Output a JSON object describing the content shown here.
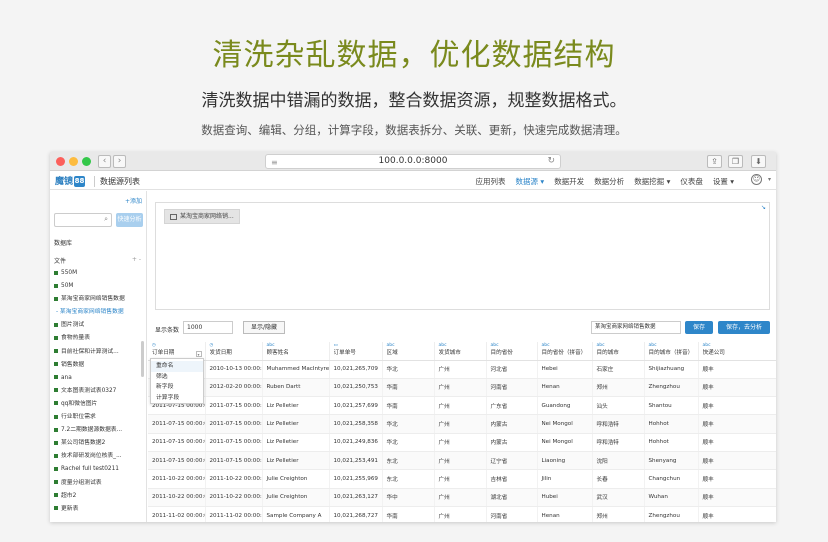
{
  "hero": {
    "title": "清洗杂乱数据，优化数据结构",
    "subtitle": "清洗数据中错漏的数据，整合数据资源，规整数据格式。",
    "description": "数据查询、编辑、分组，计算字段，数据表拆分、关联、更新，快速完成数据清理。"
  },
  "browser": {
    "url": "100.0.0.0:8000",
    "dot_colors": [
      "#fc605c",
      "#fdbc40",
      "#34c84a"
    ]
  },
  "app": {
    "logo_text": "魔镜",
    "logo_badge": "88",
    "page_title": "数据源列表",
    "nav": [
      "应用列表",
      "数据源",
      "数据开发",
      "数据分析",
      "数据挖掘",
      "仪表盘",
      "设置"
    ],
    "active_nav": "数据源"
  },
  "sidebar": {
    "add_label": "+添加",
    "quick_analyze": "快速分析",
    "database_label": "数据库",
    "file_label": "文件",
    "file_plus": "+ -",
    "items": [
      "550M",
      "50M",
      "某淘宝商家网络销售数据",
      "- 某淘宝商家网络销售数据",
      "图片测试",
      "食物热量表",
      "目前社保和计算测试...",
      "销售数据",
      "ana",
      "文本图表测试表0327",
      "qq和微信图片",
      "行业职位需求",
      "7.2二期数据源数据表...",
      "某公司销售数据2",
      "技术部研发岗位核表_...",
      "Rachel full test0211",
      "度量分组测试表",
      "超市2",
      "更新表"
    ],
    "active_index": 3
  },
  "canvas": {
    "table_chip": "某淘宝商家网络销..."
  },
  "controls": {
    "rows_label": "显示条数",
    "rows_value": "1000",
    "toggle_label": "显示/隐藏",
    "dataset_name": "某淘宝商家网络销售数据",
    "save": "保存",
    "save_analyze": "保存，去分析"
  },
  "dropdown": {
    "items": [
      "重命名",
      "筛选",
      "新字段",
      "计算字段"
    ]
  },
  "table": {
    "columns": [
      {
        "type": "◷",
        "name": "订单日期"
      },
      {
        "type": "◷",
        "name": "发货日期"
      },
      {
        "type": "abc",
        "name": "顾客姓名"
      },
      {
        "type": "▭",
        "name": "订单单号"
      },
      {
        "type": "abc",
        "name": "区域"
      },
      {
        "type": "abc",
        "name": "发货城市"
      },
      {
        "type": "abc",
        "name": "目的省份"
      },
      {
        "type": "abc",
        "name": "目的省份（拼音）"
      },
      {
        "type": "abc",
        "name": "目的城市"
      },
      {
        "type": "abc",
        "name": "目的城市（拼音）"
      },
      {
        "type": "abc",
        "name": "快递公司"
      }
    ],
    "rows": [
      [
        "",
        "2010-10-13 00:00:00",
        "Muhammed MacIntyre",
        "10,021,265,709",
        "华北",
        "广州",
        "河北省",
        "Hebei",
        "石家庄",
        "Shijiazhuang",
        "顺丰"
      ],
      [
        "",
        "2012-02-20 00:00:00",
        "Ruben Dartt",
        "10,021,250,753",
        "华南",
        "广州",
        "河南省",
        "Henan",
        "郑州",
        "Zhengzhou",
        "顺丰"
      ],
      [
        "2011-07-15 00:00:00",
        "2011-07-15 00:00:00",
        "Liz Pelletier",
        "10,021,257,699",
        "华南",
        "广州",
        "广东省",
        "Guandong",
        "汕头",
        "Shantou",
        "顺丰"
      ],
      [
        "2011-07-15 00:00:00",
        "2011-07-15 00:00:00",
        "Liz Pelletier",
        "10,021,258,358",
        "华北",
        "广州",
        "内蒙古",
        "Nei Mongol",
        "呼和浩特",
        "Hohhot",
        "顺丰"
      ],
      [
        "2011-07-15 00:00:00",
        "2011-07-15 00:00:00",
        "Liz Pelletier",
        "10,021,249,836",
        "华北",
        "广州",
        "内蒙古",
        "Nei Mongol",
        "呼和浩特",
        "Hohhot",
        "顺丰"
      ],
      [
        "2011-07-15 00:00:00",
        "2011-07-15 00:00:00",
        "Liz Pelletier",
        "10,021,253,491",
        "东北",
        "广州",
        "辽宁省",
        "Liaoning",
        "沈阳",
        "Shenyang",
        "顺丰"
      ],
      [
        "2011-10-22 00:00:00",
        "2011-10-22 00:00:00",
        "Julie Creighton",
        "10,021,255,969",
        "东北",
        "广州",
        "吉林省",
        "Jilin",
        "长春",
        "Changchun",
        "顺丰"
      ],
      [
        "2011-10-22 00:00:00",
        "2011-10-22 00:00:00",
        "Julie Creighton",
        "10,021,263,127",
        "华中",
        "广州",
        "湖北省",
        "Hubei",
        "武汉",
        "Wuhan",
        "顺丰"
      ],
      [
        "2011-11-02 00:00:00",
        "2011-11-02 00:00:00",
        "Sample Company A",
        "10,021,268,727",
        "华南",
        "广州",
        "河南省",
        "Henan",
        "郑州",
        "Zhengzhou",
        "顺丰"
      ]
    ]
  }
}
